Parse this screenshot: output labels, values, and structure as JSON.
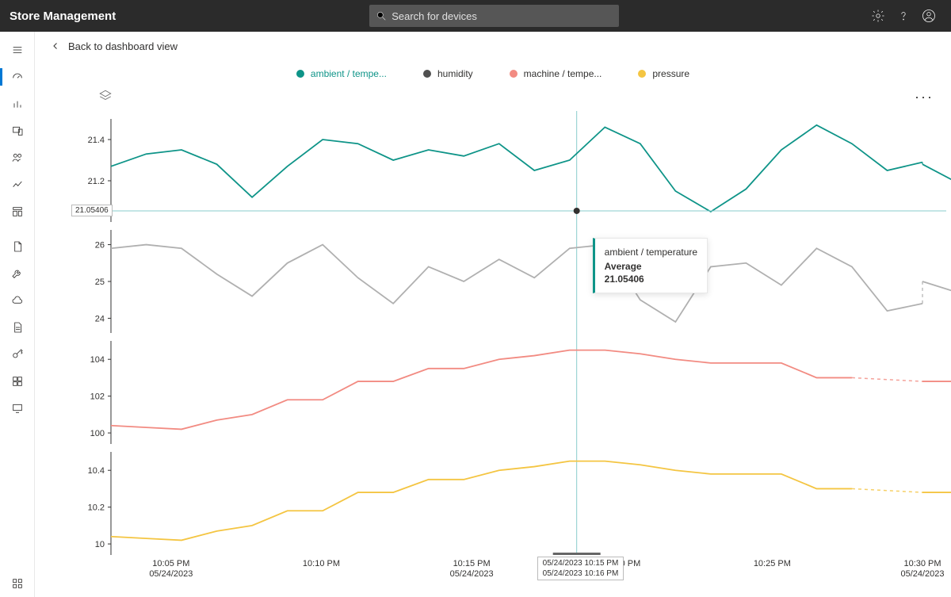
{
  "header": {
    "title": "Store Management",
    "search_placeholder": "Search for devices"
  },
  "breadcrumb": {
    "back": "Back to dashboard view"
  },
  "legend": [
    {
      "label": "ambient / tempe...",
      "color": "#0e9488",
      "selected": true
    },
    {
      "label": "humidity",
      "color": "#505050",
      "selected": false
    },
    {
      "label": "machine / tempe...",
      "color": "#f28b82",
      "selected": false
    },
    {
      "label": "pressure",
      "color": "#f4c542",
      "selected": false
    }
  ],
  "cursor": {
    "x_label_1": "05/24/2023 10:15 PM",
    "x_label_2": "05/24/2023 10:16 PM",
    "y_badge": "21.05406"
  },
  "tooltip": {
    "series": "ambient / temperature",
    "agg": "Average",
    "value": "21.05406"
  },
  "more_label": "···",
  "chart_data": {
    "type": "line",
    "xlabel": "",
    "x_ticks": [
      {
        "line1": "10:05 PM",
        "line2": "05/24/2023"
      },
      {
        "line1": "10:10 PM",
        "line2": ""
      },
      {
        "line1": "10:15 PM",
        "line2": "05/24/2023"
      },
      {
        "line1": "10:20 PM",
        "line2": ""
      },
      {
        "line1": "10:25 PM",
        "line2": ""
      },
      {
        "line1": "10:30 PM",
        "line2": "05/24/2023"
      }
    ],
    "x": [
      "22:03",
      "22:04",
      "22:05",
      "22:06",
      "22:07",
      "22:08",
      "22:09",
      "22:10",
      "22:11",
      "22:12",
      "22:13",
      "22:14",
      "22:15",
      "22:16",
      "22:17",
      "22:18",
      "22:19",
      "22:20",
      "22:21",
      "22:22",
      "22:23",
      "22:24",
      "22:25",
      "22:26"
    ],
    "panels": [
      {
        "name": "ambient / temperature",
        "color": "#0e9488",
        "yticks": [
          21.2,
          21.4
        ],
        "ylim": [
          21.0,
          21.5
        ],
        "values": [
          21.27,
          21.33,
          21.35,
          21.28,
          21.12,
          21.27,
          21.4,
          21.38,
          21.3,
          21.35,
          21.32,
          21.38,
          21.25,
          21.3,
          21.46,
          21.38,
          21.15,
          21.05,
          21.16,
          21.35,
          21.47,
          21.38,
          21.25,
          21.29
        ],
        "gap": [
          21,
          22
        ],
        "tail": [
          21.28,
          21.19,
          21.45
        ]
      },
      {
        "name": "humidity",
        "color": "#b0b0b0",
        "yticks": [
          24,
          25,
          26
        ],
        "ylim": [
          23.6,
          26.4
        ],
        "values": [
          25.9,
          26.0,
          25.9,
          25.2,
          24.6,
          25.5,
          26.0,
          25.1,
          24.4,
          25.4,
          25.0,
          25.6,
          25.1,
          25.9,
          26.0,
          24.5,
          23.9,
          25.4,
          25.5,
          24.9,
          25.9,
          25.4,
          24.2,
          24.4
        ],
        "gap": [
          21,
          22
        ],
        "tail": [
          25.0,
          24.7,
          26.0
        ]
      },
      {
        "name": "machine / temperature",
        "color": "#f28b82",
        "yticks": [
          100,
          102,
          104
        ],
        "ylim": [
          99.4,
          105.0
        ],
        "values": [
          100.4,
          100.3,
          100.2,
          100.7,
          101.0,
          101.8,
          101.8,
          102.8,
          102.8,
          103.5,
          103.5,
          104.0,
          104.2,
          104.5,
          104.5,
          104.3,
          104.0,
          103.8,
          103.8,
          103.8,
          103.0,
          103.0
        ],
        "gap": [
          21,
          22
        ],
        "tail": [
          102.8,
          102.8,
          102.9
        ]
      },
      {
        "name": "pressure",
        "color": "#f4c542",
        "yticks": [
          10,
          10.2,
          10.4
        ],
        "ylim": [
          9.94,
          10.5
        ],
        "values": [
          10.04,
          10.03,
          10.02,
          10.07,
          10.1,
          10.18,
          10.18,
          10.28,
          10.28,
          10.35,
          10.35,
          10.4,
          10.42,
          10.45,
          10.45,
          10.43,
          10.4,
          10.38,
          10.38,
          10.38,
          10.3,
          10.3
        ],
        "gap": [
          21,
          22
        ],
        "tail": [
          10.28,
          10.28,
          10.29
        ]
      }
    ]
  }
}
